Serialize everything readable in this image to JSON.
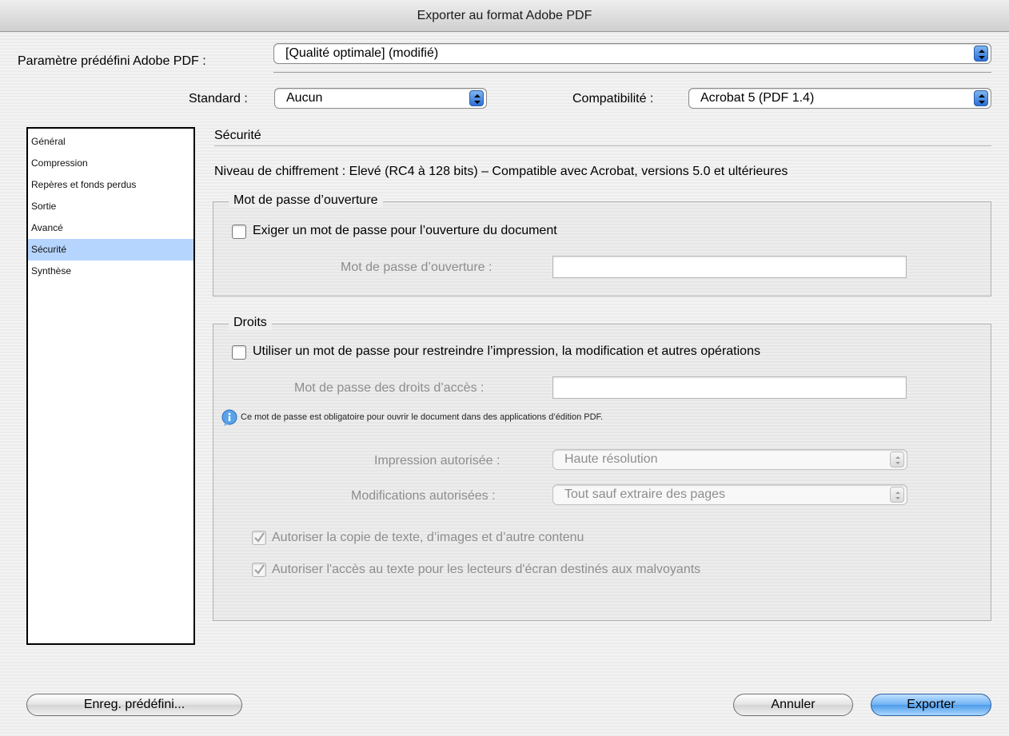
{
  "window": {
    "title": "Exporter au format Adobe PDF"
  },
  "preset": {
    "label": "Paramètre prédéfini Adobe PDF :",
    "value": "[Qualité optimale] (modifié)"
  },
  "standard": {
    "label": "Standard :",
    "value": "Aucun"
  },
  "compatibility": {
    "label": "Compatibilité :",
    "value": "Acrobat 5 (PDF 1.4)"
  },
  "sidebar": {
    "items": [
      {
        "label": "Général"
      },
      {
        "label": "Compression"
      },
      {
        "label": "Repères et fonds perdus"
      },
      {
        "label": "Sortie"
      },
      {
        "label": "Avancé"
      },
      {
        "label": "Sécurité",
        "selected": true
      },
      {
        "label": "Synthèse"
      }
    ]
  },
  "panel": {
    "title": "Sécurité",
    "encryption_level": "Niveau de chiffrement : Elevé (RC4 à 128 bits) – Compatible avec Acrobat, versions 5.0 et ultérieures"
  },
  "open_password": {
    "legend": "Mot de passe d’ouverture",
    "checkbox_label": "Exiger un mot de passe pour l’ouverture du document",
    "checked": false,
    "field_label": "Mot de passe d’ouverture :",
    "field_value": ""
  },
  "rights": {
    "legend": "Droits",
    "checkbox_label": "Utiliser un mot de passe pour restreindre l’impression, la modification et autres opérations",
    "checked": false,
    "field_label": "Mot de passe des droits d’accès :",
    "field_value": "",
    "info_text": "Ce mot de passe est obligatoire pour ouvrir le document dans des applications d’édition PDF.",
    "printing_label": "Impression autorisée :",
    "printing_value": "Haute résolution",
    "changes_label": "Modifications autorisées :",
    "changes_value": "Tout sauf extraire des pages",
    "copy_label": "Autoriser la copie de texte, d’images et d’autre contenu",
    "copy_checked": true,
    "access_label": "Autoriser l'accès au texte pour les lecteurs d'écran destinés aux malvoyants",
    "access_checked": true
  },
  "buttons": {
    "save_preset": "Enreg. prédéfini...",
    "cancel": "Annuler",
    "export": "Exporter"
  },
  "colors": {
    "selection": "#b5d5ff",
    "accent": "#4d9cea"
  }
}
